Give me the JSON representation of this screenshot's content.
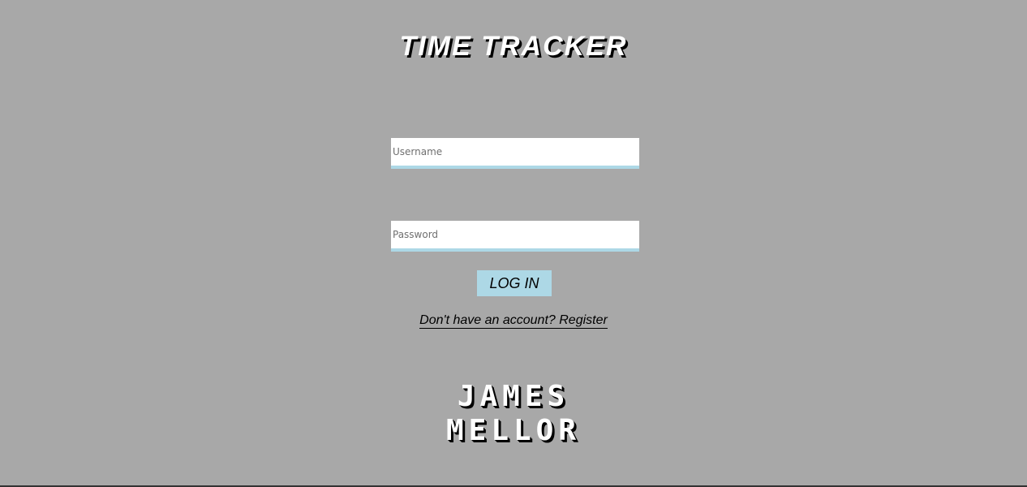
{
  "app": {
    "title": "TIME TRACKER"
  },
  "form": {
    "username_placeholder": "Username",
    "password_placeholder": "Password",
    "username_value": "",
    "password_value": "",
    "login_label": "LOG IN",
    "register_label": "Don't have an account? Register"
  },
  "logo": {
    "line1": "JAMES",
    "line2": "MELLOR"
  },
  "colors": {
    "background": "#a8a8a8",
    "accent": "#add8e6",
    "input_background": "#ffffff"
  }
}
